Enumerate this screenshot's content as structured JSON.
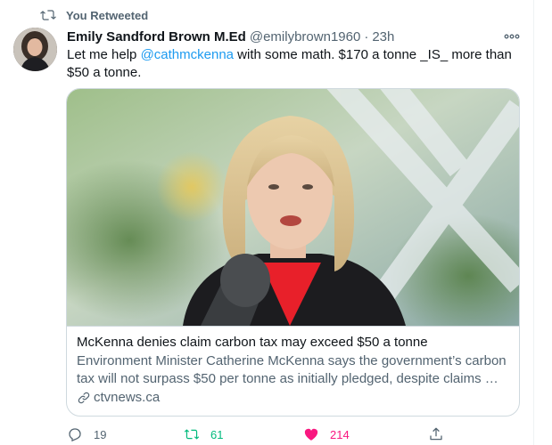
{
  "retweet_banner": {
    "text": "You Retweeted",
    "icon": "retweet-icon"
  },
  "tweet": {
    "author_name": "Emily Sandford Brown M.Ed",
    "author_handle": "@emilybrown1960",
    "separator": "·",
    "timestamp": "23h",
    "text_before": "Let me help ",
    "mention": "@cathmckenna",
    "text_after": " with some math. $170 a tonne _IS_ more than $50 a tonne."
  },
  "card": {
    "title": "McKenna denies claim carbon tax may exceed $50 a tonne",
    "description": "Environment Minister Catherine McKenna says the government’s carbon tax will not surpass $50 per tonne as initially pledged, despite claims …",
    "domain": "ctvnews.ca"
  },
  "actions": {
    "reply_count": "19",
    "retweet_count": "61",
    "like_count": "214"
  },
  "colors": {
    "accent": "#1d9bf0",
    "retweet_green": "#00ba7c",
    "like_pink": "#f91880",
    "secondary_text": "#536471"
  }
}
